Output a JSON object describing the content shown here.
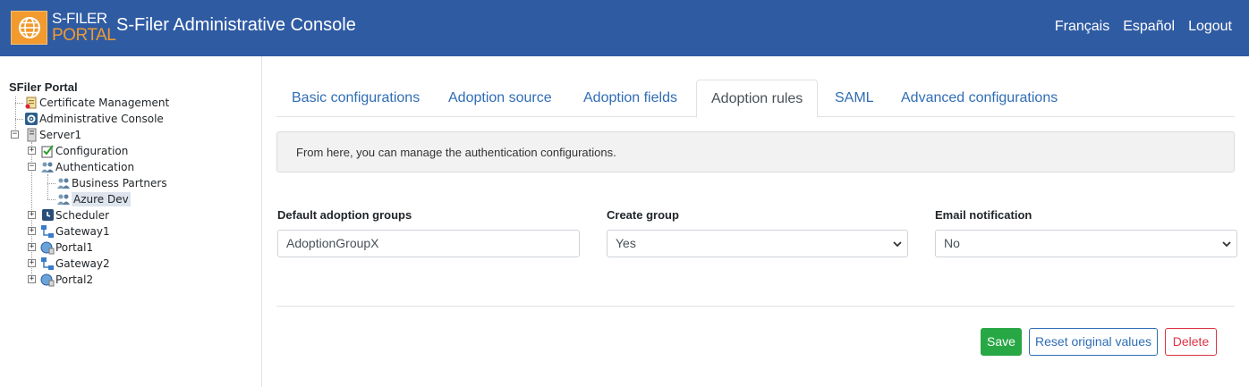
{
  "header": {
    "logo_line1": "S-FILER",
    "logo_line2": "PORTAL",
    "title": "S-Filer Administrative Console",
    "nav": [
      "Français",
      "Español",
      "Logout"
    ]
  },
  "tree": {
    "root": "SFiler Portal",
    "nodes": {
      "certificate_management": "Certificate Management",
      "administrative_console": "Administrative Console",
      "server1": "Server1",
      "configuration": "Configuration",
      "authentication": "Authentication",
      "business_partners": "Business Partners",
      "azure_dev": "Azure Dev",
      "scheduler": "Scheduler",
      "gateway1": "Gateway1",
      "portal1": "Portal1",
      "gateway2": "Gateway2",
      "portal2": "Portal2"
    },
    "selected": "Azure Dev"
  },
  "tabs": [
    {
      "label": "Basic configurations",
      "active": false
    },
    {
      "label": "Adoption source",
      "active": false
    },
    {
      "label": "Adoption fields",
      "active": false
    },
    {
      "label": "Adoption rules",
      "active": true
    },
    {
      "label": "SAML",
      "active": false
    },
    {
      "label": "Advanced configurations",
      "active": false
    }
  ],
  "info_text": "From here, you can manage the authentication configurations.",
  "form": {
    "default_groups_label": "Default adoption groups",
    "default_groups_value": "AdoptionGroupX",
    "create_group_label": "Create group",
    "create_group_value": "Yes",
    "email_notification_label": "Email notification",
    "email_notification_value": "No"
  },
  "buttons": {
    "save": "Save",
    "reset": "Reset original values",
    "delete": "Delete"
  },
  "colors": {
    "header_bg": "#2f5ba3",
    "logo_orange": "#f29a2e",
    "link_blue": "#2f6db5",
    "save_green": "#28a745",
    "delete_red": "#dc3545"
  }
}
